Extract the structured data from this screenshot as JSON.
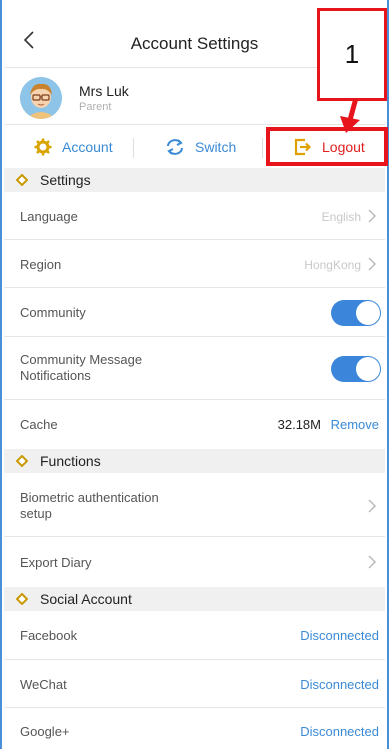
{
  "header": {
    "title": "Account Settings"
  },
  "profile": {
    "name": "Mrs Luk",
    "role": "Parent"
  },
  "actions": {
    "account_label": "Account",
    "switch_label": "Switch",
    "logout_label": "Logout"
  },
  "annotation": {
    "step_number": "1"
  },
  "settings": {
    "heading": "Settings",
    "language": {
      "label": "Language",
      "value": "English"
    },
    "region": {
      "label": "Region",
      "value": "HongKong"
    },
    "community": {
      "label": "Community",
      "on": true
    },
    "community_notifications": {
      "label_line1": "Community Message",
      "label_line2": "Notifications",
      "on": true
    },
    "cache": {
      "label": "Cache",
      "value": "32.18M",
      "action": "Remove"
    }
  },
  "functions": {
    "heading": "Functions",
    "biometric": {
      "label_line1": "Biometric authentication",
      "label_line2": "setup"
    },
    "export_diary": {
      "label": "Export Diary"
    }
  },
  "social": {
    "heading": "Social Account",
    "items": [
      {
        "label": "Facebook",
        "status": "Disconnected"
      },
      {
        "label": "WeChat",
        "status": "Disconnected"
      },
      {
        "label": "Google+",
        "status": "Disconnected"
      }
    ]
  },
  "colors": {
    "accent": "#3a8ad6",
    "toggle_on": "#3b86db",
    "logout": "#e02020",
    "highlight": "#e8141b"
  }
}
